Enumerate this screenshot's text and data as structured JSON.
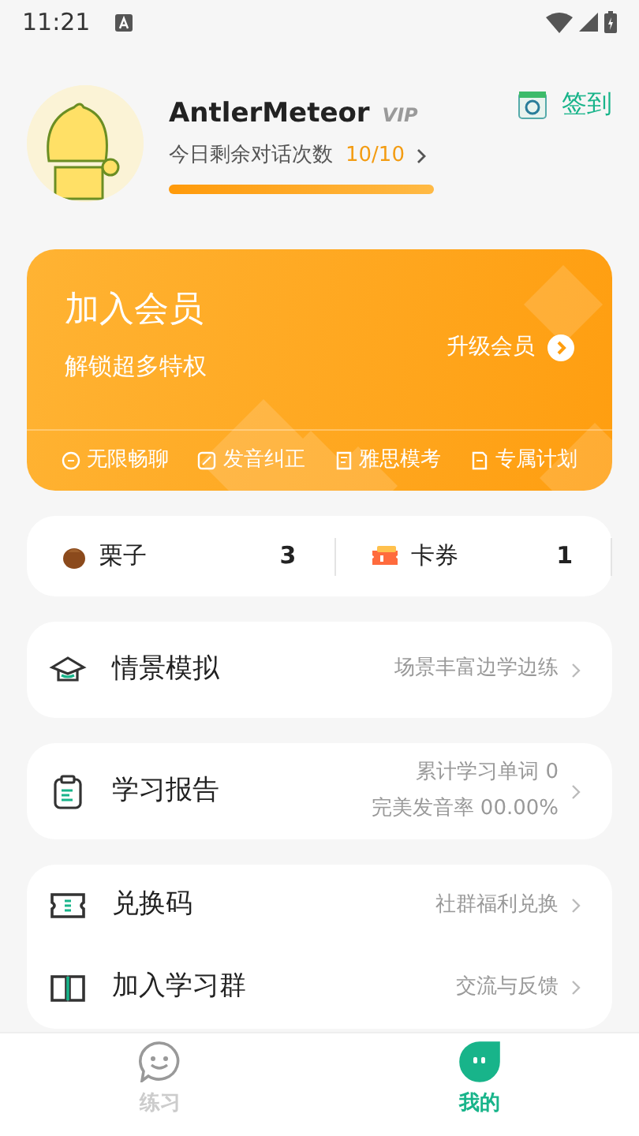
{
  "status_bar": {
    "time": "11:21"
  },
  "profile": {
    "name": "AntlerMeteor",
    "vip": "VIP",
    "remaining_label": "今日剩余对话次数",
    "remaining": "10/10",
    "level": 1,
    "sign_in": "签到"
  },
  "membership": {
    "title": "加入会员",
    "subtitle": "解锁超多特权",
    "upgrade": "升级会员",
    "perks": [
      {
        "kind": "chat",
        "label": "无限畅聊"
      },
      {
        "kind": "pronunciation",
        "label": "发音纠正"
      },
      {
        "kind": "exam",
        "label": "雅思模考"
      },
      {
        "kind": "plan",
        "label": "专属计划"
      }
    ]
  },
  "stats": [
    {
      "kind": "chestnut",
      "label": "栗子",
      "value": "3"
    },
    {
      "kind": "coupon",
      "label": "卡券",
      "value": "1"
    }
  ],
  "menu_groups": [
    [
      {
        "kind": "scene",
        "title": "情景模拟",
        "details": [
          "场景丰富边学边练"
        ]
      }
    ],
    [
      {
        "kind": "report",
        "title": "学习报告",
        "details": [
          "累计学习单词 0",
          "完美发音率 00.00%"
        ]
      }
    ],
    [
      {
        "kind": "redeem",
        "title": "兑换码",
        "details": [
          "社群福利兑换"
        ]
      },
      {
        "kind": "group",
        "title": "加入学习群",
        "details": [
          "交流与反馈"
        ]
      }
    ]
  ],
  "tabs": [
    {
      "kind": "practice",
      "label": "练习",
      "selected": false
    },
    {
      "kind": "mine",
      "label": "我的",
      "selected": true
    }
  ]
}
